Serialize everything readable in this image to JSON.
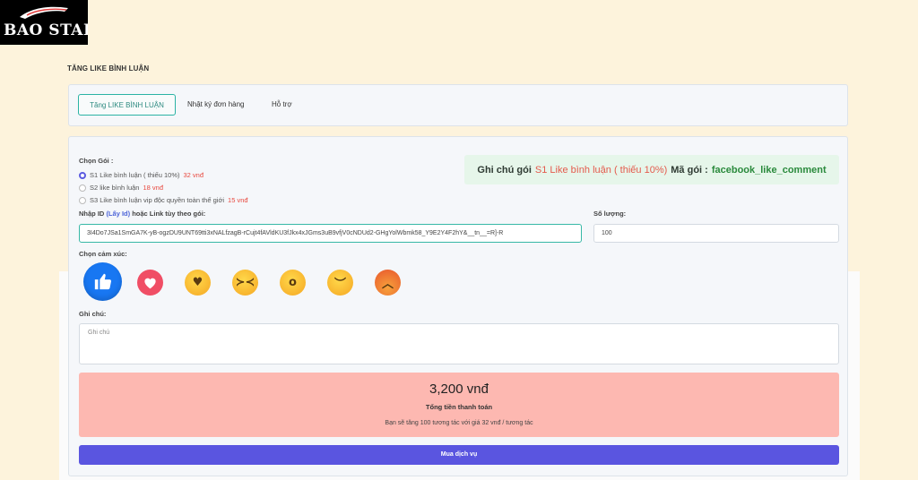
{
  "logo": {
    "text": "BAO STAR"
  },
  "page_title": "TĂNG LIKE BÌNH LUẬN",
  "tabs": [
    {
      "label": "Tăng LIKE BÌNH LUẬN",
      "active": true
    },
    {
      "label": "Nhật ký đơn hàng",
      "active": false
    },
    {
      "label": "Hỗ trợ",
      "active": false
    }
  ],
  "form": {
    "package_label": "Chọn Gói :",
    "packages": [
      {
        "name": "S1 Like bình luận ( thiếu 10%)",
        "price": "32 vnđ",
        "selected": true
      },
      {
        "name": "S2 like bình luận",
        "price": "18 vnđ",
        "selected": false
      },
      {
        "name": "S3 Like bình luận vip độc quyền toàn thế giới",
        "price": "15 vnđ",
        "selected": false
      }
    ],
    "note": {
      "prefix": "Ghi chú gói",
      "package": "S1 Like bình luận ( thiếu 10%)",
      "code_label": "Mã gói :",
      "code": "facebook_like_comment"
    },
    "id_label_prefix": "Nhập ID",
    "id_label_link": "(Lấy Id)",
    "id_label_suffix": "hoặc Link tùy theo gói:",
    "id_value": "3I4Do7JSa1SmGA7K-yB-ogzDU9UNT69tti3xNALfzagB-rCujt4fAVldKU3fJkx4xJGms3uB9vfjV0cNDUd2-GHgYolWbmk58_Y9E2Y4F2hY&__tn__=R]-R",
    "quantity_label": "Số lượng:",
    "quantity_value": "100",
    "emotion_label": "Chọn cảm xúc:",
    "emotions": [
      "like-icon",
      "love-icon",
      "care-icon",
      "haha-icon",
      "wow-icon",
      "sad-icon",
      "angry-icon"
    ],
    "notes_label": "Ghi chú:",
    "notes_placeholder": "Ghi chú"
  },
  "summary": {
    "total": "3,200 vnđ",
    "total_label": "Tổng tiền thanh toán",
    "description": "Bạn sẽ tăng 100 tương tác với giá 32 vnđ / tương tác"
  },
  "buy_button": "Mua dịch vụ",
  "colors": {
    "background": "#fdf3dc",
    "accent_teal": "#2bb3a4",
    "price_red": "#e8493f",
    "total_bg": "#fdb8b1",
    "buy_button": "#5a55e0",
    "note_bg": "#e6f6ea",
    "code_green": "#2a8a3c"
  }
}
